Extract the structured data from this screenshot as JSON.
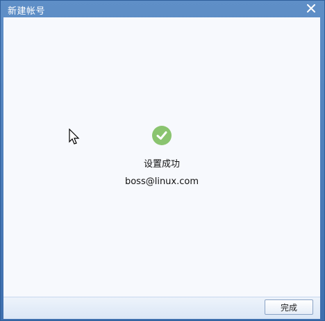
{
  "window": {
    "title": "新建帐号"
  },
  "dialog": {
    "success_message": "设置成功",
    "account_email": "boss@linux.com",
    "done_label": "完成"
  },
  "icons": {
    "close": "close-icon",
    "success": "check-circle-icon",
    "cursor": "mouse-cursor-icon"
  },
  "colors": {
    "titlebar": "#4f80bd",
    "content_bg": "#f7f9fd",
    "success_green": "#8ac46f"
  }
}
